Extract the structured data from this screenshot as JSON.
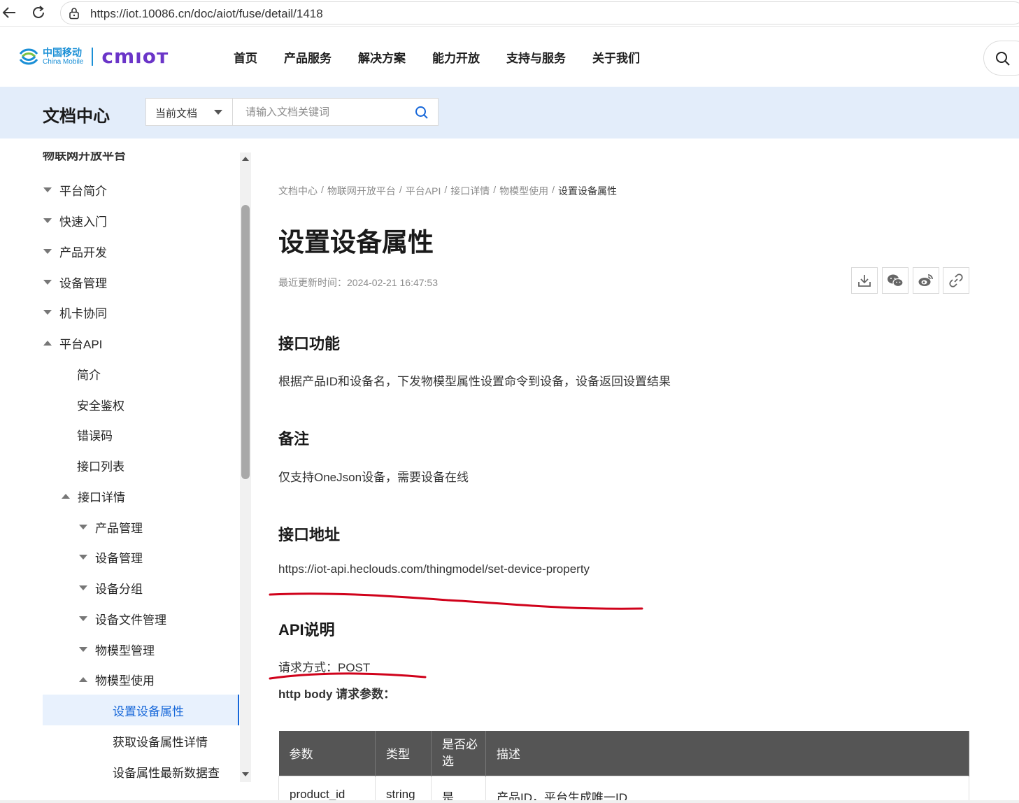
{
  "browser": {
    "url": "https://iot.10086.cn/doc/aiot/fuse/detail/1418"
  },
  "header": {
    "logo_zh": "中国移动",
    "logo_en": "China Mobile",
    "logo_brand": "cmıoт",
    "nav": [
      "首页",
      "产品服务",
      "解决方案",
      "能力开放",
      "支持与服务",
      "关于我们"
    ]
  },
  "doc_banner": {
    "title": "文档中心",
    "scope_label": "当前文档",
    "search_placeholder": "请输入文档关键词"
  },
  "sidebar": {
    "section_title": "物联网开放平台",
    "items": [
      {
        "label": "平台简介",
        "state": "collapsed"
      },
      {
        "label": "快速入门",
        "state": "collapsed"
      },
      {
        "label": "产品开发",
        "state": "collapsed"
      },
      {
        "label": "设备管理",
        "state": "collapsed"
      },
      {
        "label": "机卡协同",
        "state": "collapsed"
      },
      {
        "label": "平台API",
        "state": "expanded"
      },
      {
        "label": "简介",
        "state": "leaf"
      },
      {
        "label": "安全鉴权",
        "state": "leaf"
      },
      {
        "label": "错误码",
        "state": "leaf"
      },
      {
        "label": "接口列表",
        "state": "leaf"
      },
      {
        "label": "接口详情",
        "state": "expanded"
      },
      {
        "label": "产品管理",
        "state": "collapsed"
      },
      {
        "label": "设备管理",
        "state": "collapsed"
      },
      {
        "label": "设备分组",
        "state": "collapsed"
      },
      {
        "label": "设备文件管理",
        "state": "collapsed"
      },
      {
        "label": "物模型管理",
        "state": "collapsed"
      },
      {
        "label": "物模型使用",
        "state": "expanded"
      },
      {
        "label": "设置设备属性",
        "state": "active"
      },
      {
        "label": "获取设备属性详情",
        "state": "leaf"
      },
      {
        "label": "设备属性最新数据查",
        "state": "leaf"
      }
    ]
  },
  "content": {
    "breadcrumb": [
      "文档中心",
      "/",
      "物联网开放平台",
      "/",
      "平台API",
      "/",
      "接口详情",
      "/",
      "物模型使用",
      "/",
      "设置设备属性"
    ],
    "title": "设置设备属性",
    "updated": "最近更新时间：2024-02-21 16:47:53",
    "sections": {
      "function_heading": "接口功能",
      "function_text": "根据产品ID和设备名，下发物模型属性设置命令到设备，设备返回设置结果",
      "note_heading": "备注",
      "note_text": "仅支持OneJson设备，需要设备在线",
      "address_heading": "接口地址",
      "address_text": "https://iot-api.heclouds.com/thingmodel/set-device-property",
      "api_heading": "API说明",
      "method_text": "请求方式：POST",
      "body_params": "http body 请求参数："
    },
    "table": {
      "headers": [
        "参数",
        "类型",
        "是否必选",
        "描述"
      ],
      "rows": [
        [
          "product_id",
          "string",
          "是",
          "产品ID，平台生成唯一ID"
        ]
      ]
    }
  },
  "colors": {
    "accent": "#1667d9",
    "banner_bg": "#e3edfa",
    "table_header": "#555555",
    "annotation": "#d0021b"
  }
}
